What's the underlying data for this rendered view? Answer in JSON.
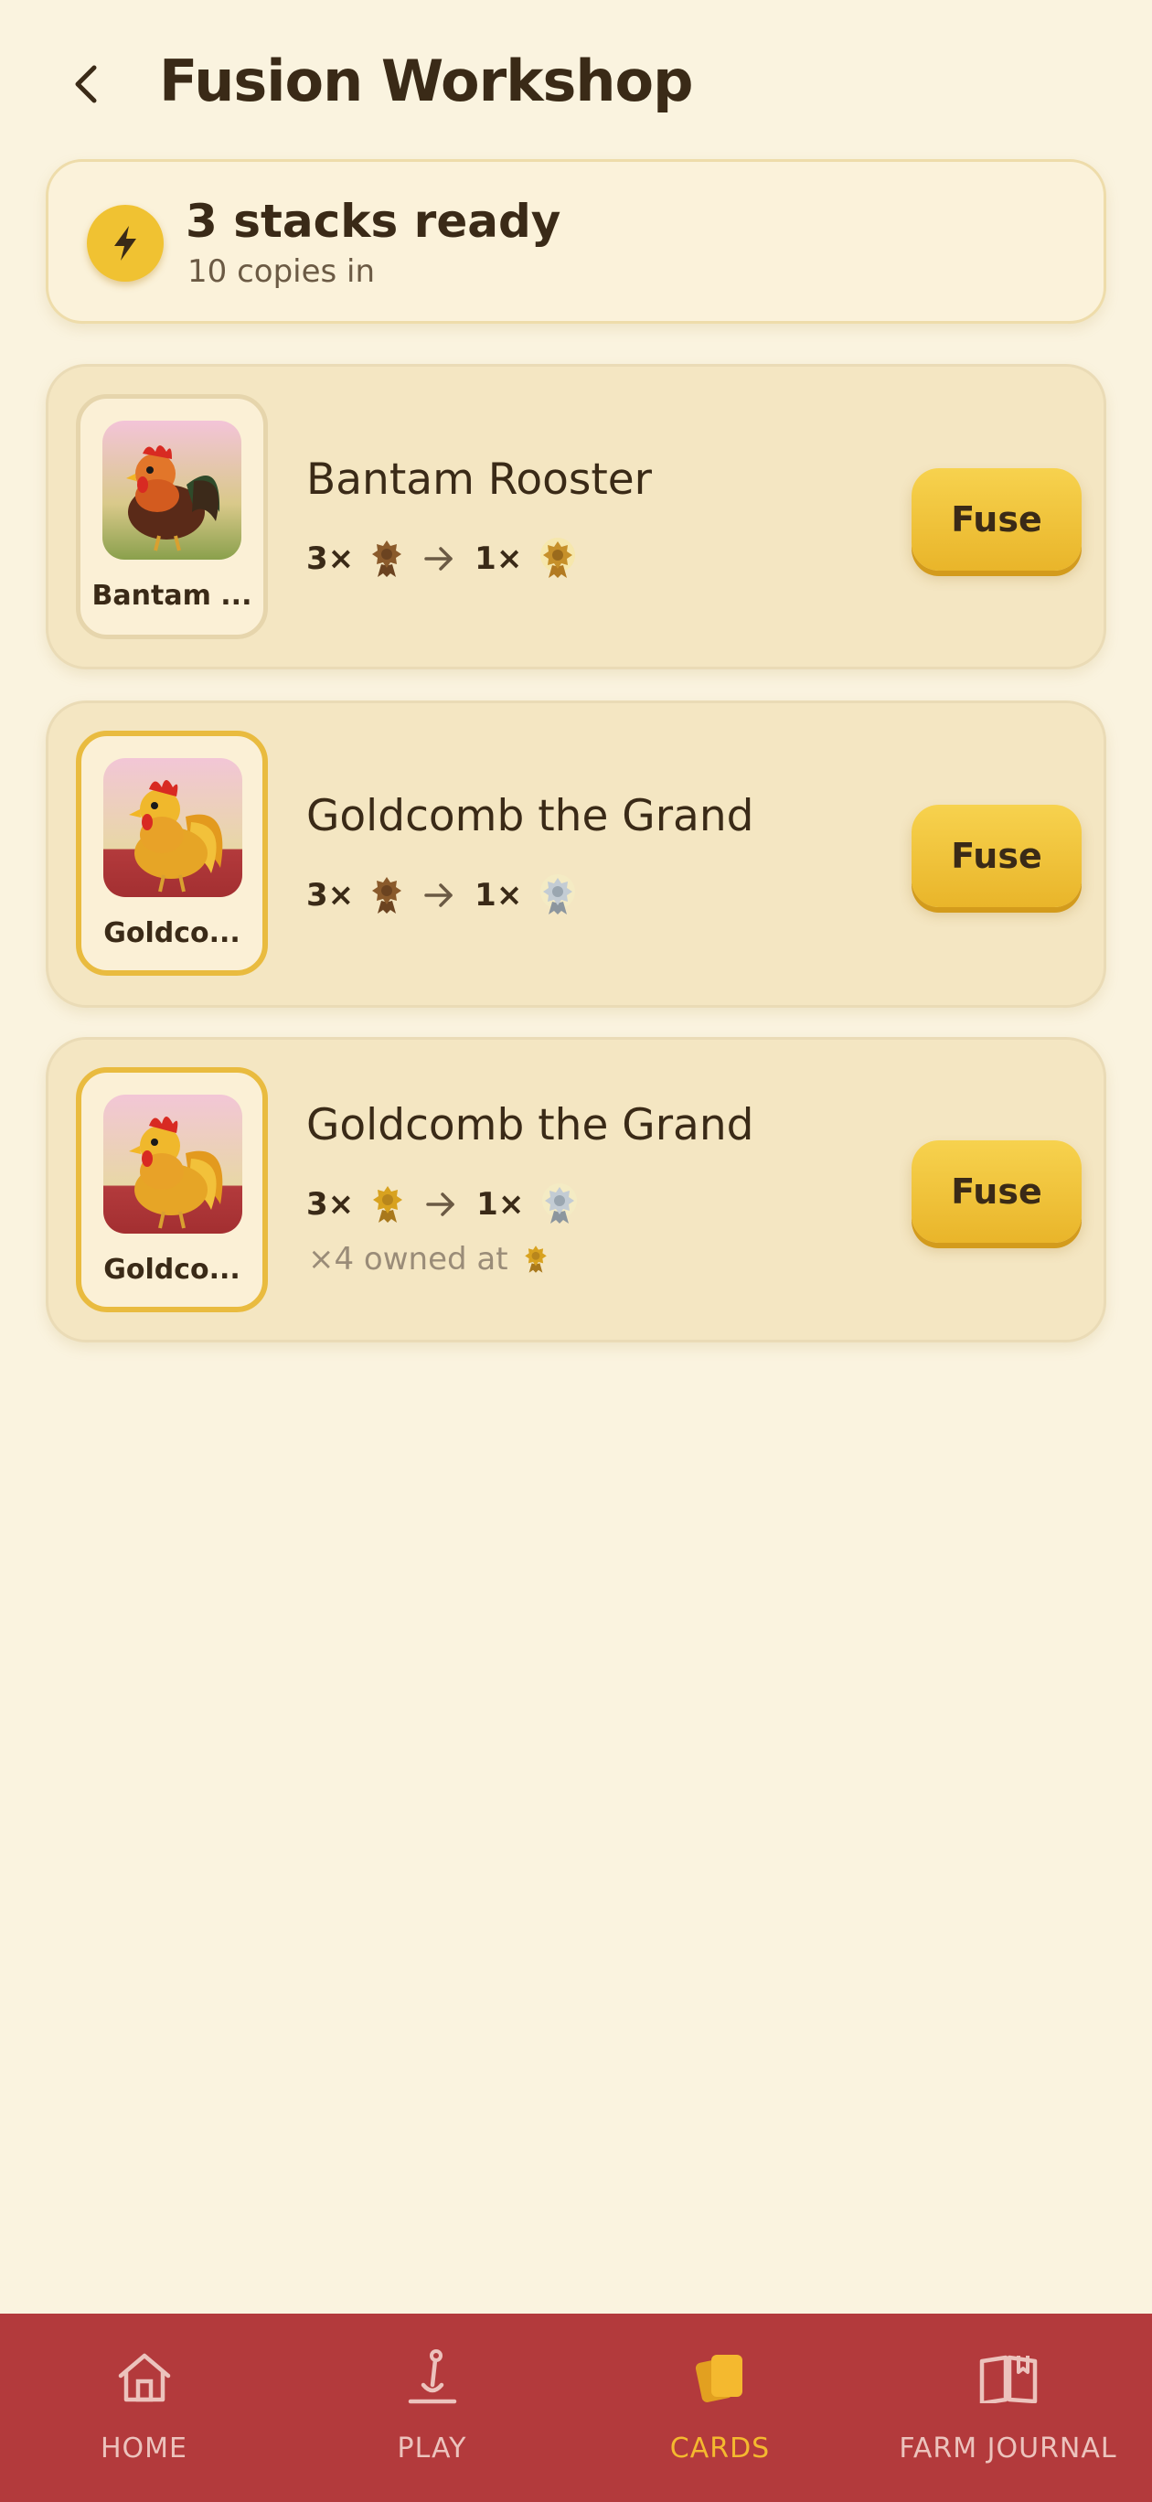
{
  "header": {
    "title": "Fusion Workshop",
    "back_icon": "chevron-left-icon"
  },
  "summary": {
    "icon": "lightning-bolt-icon",
    "title": "3 stacks ready",
    "subtitle": "10 copies in"
  },
  "stacks": [
    {
      "thumb_label": "Bantam ...",
      "name": "Bantam Rooster",
      "input_count": "3×",
      "output_count": "1×",
      "input_tier": "bronze",
      "output_tier": "gold",
      "button": "Fuse",
      "owned_note": null
    },
    {
      "thumb_label": "Goldco...",
      "name": "Goldcomb the Grand",
      "input_count": "3×",
      "output_count": "1×",
      "input_tier": "bronze",
      "output_tier": "silver",
      "button": "Fuse",
      "owned_note": null
    },
    {
      "thumb_label": "Goldco...",
      "name": "Goldcomb the Grand",
      "input_count": "3×",
      "output_count": "1×",
      "input_tier": "gold",
      "output_tier": "silver",
      "button": "Fuse",
      "owned_note": "×4 owned at"
    }
  ],
  "nav": {
    "items": [
      {
        "label": "HOME",
        "icon": "home-icon",
        "active": false
      },
      {
        "label": "PLAY",
        "icon": "shovel-icon",
        "active": false
      },
      {
        "label": "CARDS",
        "icon": "cards-icon",
        "active": true
      },
      {
        "label": "FARM JOURNAL",
        "icon": "journal-icon",
        "active": false
      }
    ]
  },
  "colors": {
    "background": "#faf3df",
    "accent": "#f0c232",
    "nav_bar": "#b33a3c",
    "nav_active": "#f4b92f",
    "bronze": "#8a5a2b",
    "gold": "#d8a21f",
    "silver": "#b9c3cc"
  }
}
